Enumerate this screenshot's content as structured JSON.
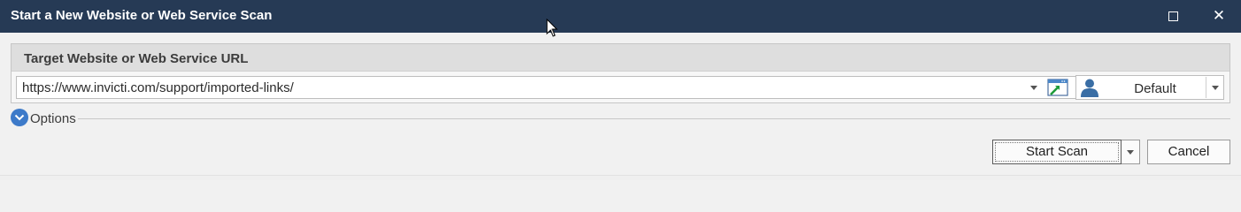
{
  "window": {
    "title": "Start a New Website or Web Service Scan",
    "maximize_icon": "maximize-icon",
    "close_icon": "close-icon",
    "titlebar_color": "#263a55"
  },
  "target": {
    "group_title": "Target Website or Web Service URL",
    "url_value": "https://www.invicti.com/support/imported-links/",
    "browser_icon": "open-in-browser-icon"
  },
  "profile": {
    "icon": "user-icon",
    "label": "Default"
  },
  "options": {
    "label": "Options",
    "icon": "chevron-down-circle-icon",
    "accent": "#3d7ac9"
  },
  "actions": {
    "start_label": "Start Scan",
    "cancel_label": "Cancel"
  }
}
